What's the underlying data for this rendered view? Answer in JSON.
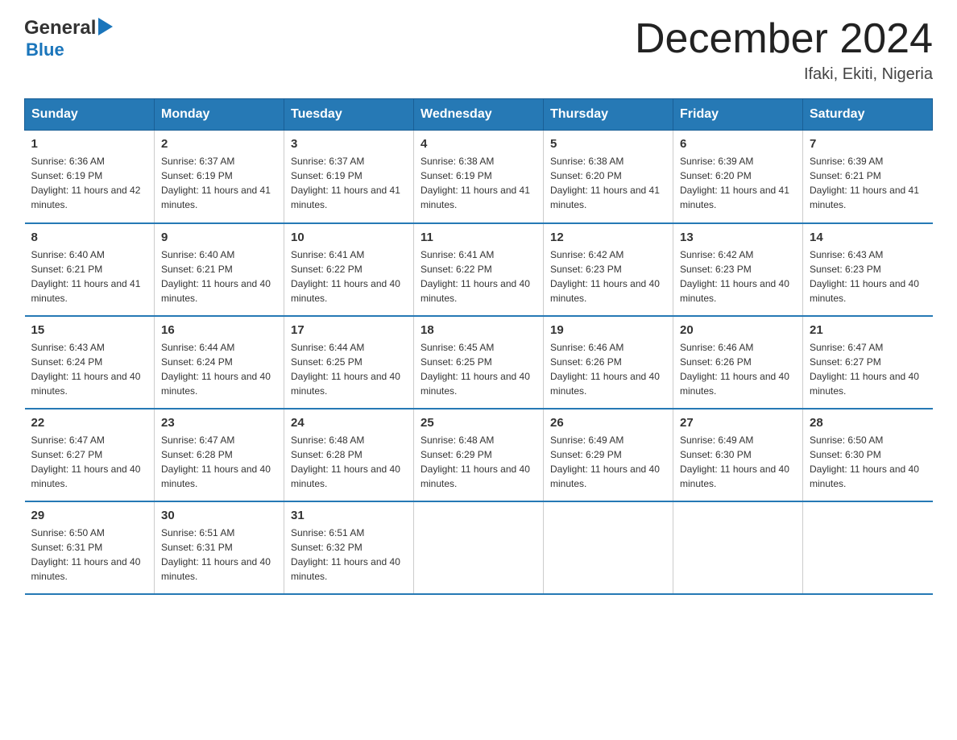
{
  "logo": {
    "text_general": "General",
    "arrow": "▶",
    "text_blue": "Blue"
  },
  "header": {
    "month": "December 2024",
    "location": "Ifaki, Ekiti, Nigeria"
  },
  "days_of_week": [
    "Sunday",
    "Monday",
    "Tuesday",
    "Wednesday",
    "Thursday",
    "Friday",
    "Saturday"
  ],
  "weeks": [
    [
      {
        "day": "1",
        "sunrise": "6:36 AM",
        "sunset": "6:19 PM",
        "daylight": "11 hours and 42 minutes."
      },
      {
        "day": "2",
        "sunrise": "6:37 AM",
        "sunset": "6:19 PM",
        "daylight": "11 hours and 41 minutes."
      },
      {
        "day": "3",
        "sunrise": "6:37 AM",
        "sunset": "6:19 PM",
        "daylight": "11 hours and 41 minutes."
      },
      {
        "day": "4",
        "sunrise": "6:38 AM",
        "sunset": "6:19 PM",
        "daylight": "11 hours and 41 minutes."
      },
      {
        "day": "5",
        "sunrise": "6:38 AM",
        "sunset": "6:20 PM",
        "daylight": "11 hours and 41 minutes."
      },
      {
        "day": "6",
        "sunrise": "6:39 AM",
        "sunset": "6:20 PM",
        "daylight": "11 hours and 41 minutes."
      },
      {
        "day": "7",
        "sunrise": "6:39 AM",
        "sunset": "6:21 PM",
        "daylight": "11 hours and 41 minutes."
      }
    ],
    [
      {
        "day": "8",
        "sunrise": "6:40 AM",
        "sunset": "6:21 PM",
        "daylight": "11 hours and 41 minutes."
      },
      {
        "day": "9",
        "sunrise": "6:40 AM",
        "sunset": "6:21 PM",
        "daylight": "11 hours and 40 minutes."
      },
      {
        "day": "10",
        "sunrise": "6:41 AM",
        "sunset": "6:22 PM",
        "daylight": "11 hours and 40 minutes."
      },
      {
        "day": "11",
        "sunrise": "6:41 AM",
        "sunset": "6:22 PM",
        "daylight": "11 hours and 40 minutes."
      },
      {
        "day": "12",
        "sunrise": "6:42 AM",
        "sunset": "6:23 PM",
        "daylight": "11 hours and 40 minutes."
      },
      {
        "day": "13",
        "sunrise": "6:42 AM",
        "sunset": "6:23 PM",
        "daylight": "11 hours and 40 minutes."
      },
      {
        "day": "14",
        "sunrise": "6:43 AM",
        "sunset": "6:23 PM",
        "daylight": "11 hours and 40 minutes."
      }
    ],
    [
      {
        "day": "15",
        "sunrise": "6:43 AM",
        "sunset": "6:24 PM",
        "daylight": "11 hours and 40 minutes."
      },
      {
        "day": "16",
        "sunrise": "6:44 AM",
        "sunset": "6:24 PM",
        "daylight": "11 hours and 40 minutes."
      },
      {
        "day": "17",
        "sunrise": "6:44 AM",
        "sunset": "6:25 PM",
        "daylight": "11 hours and 40 minutes."
      },
      {
        "day": "18",
        "sunrise": "6:45 AM",
        "sunset": "6:25 PM",
        "daylight": "11 hours and 40 minutes."
      },
      {
        "day": "19",
        "sunrise": "6:46 AM",
        "sunset": "6:26 PM",
        "daylight": "11 hours and 40 minutes."
      },
      {
        "day": "20",
        "sunrise": "6:46 AM",
        "sunset": "6:26 PM",
        "daylight": "11 hours and 40 minutes."
      },
      {
        "day": "21",
        "sunrise": "6:47 AM",
        "sunset": "6:27 PM",
        "daylight": "11 hours and 40 minutes."
      }
    ],
    [
      {
        "day": "22",
        "sunrise": "6:47 AM",
        "sunset": "6:27 PM",
        "daylight": "11 hours and 40 minutes."
      },
      {
        "day": "23",
        "sunrise": "6:47 AM",
        "sunset": "6:28 PM",
        "daylight": "11 hours and 40 minutes."
      },
      {
        "day": "24",
        "sunrise": "6:48 AM",
        "sunset": "6:28 PM",
        "daylight": "11 hours and 40 minutes."
      },
      {
        "day": "25",
        "sunrise": "6:48 AM",
        "sunset": "6:29 PM",
        "daylight": "11 hours and 40 minutes."
      },
      {
        "day": "26",
        "sunrise": "6:49 AM",
        "sunset": "6:29 PM",
        "daylight": "11 hours and 40 minutes."
      },
      {
        "day": "27",
        "sunrise": "6:49 AM",
        "sunset": "6:30 PM",
        "daylight": "11 hours and 40 minutes."
      },
      {
        "day": "28",
        "sunrise": "6:50 AM",
        "sunset": "6:30 PM",
        "daylight": "11 hours and 40 minutes."
      }
    ],
    [
      {
        "day": "29",
        "sunrise": "6:50 AM",
        "sunset": "6:31 PM",
        "daylight": "11 hours and 40 minutes."
      },
      {
        "day": "30",
        "sunrise": "6:51 AM",
        "sunset": "6:31 PM",
        "daylight": "11 hours and 40 minutes."
      },
      {
        "day": "31",
        "sunrise": "6:51 AM",
        "sunset": "6:32 PM",
        "daylight": "11 hours and 40 minutes."
      },
      null,
      null,
      null,
      null
    ]
  ],
  "labels": {
    "sunrise": "Sunrise:",
    "sunset": "Sunset:",
    "daylight": "Daylight:"
  }
}
